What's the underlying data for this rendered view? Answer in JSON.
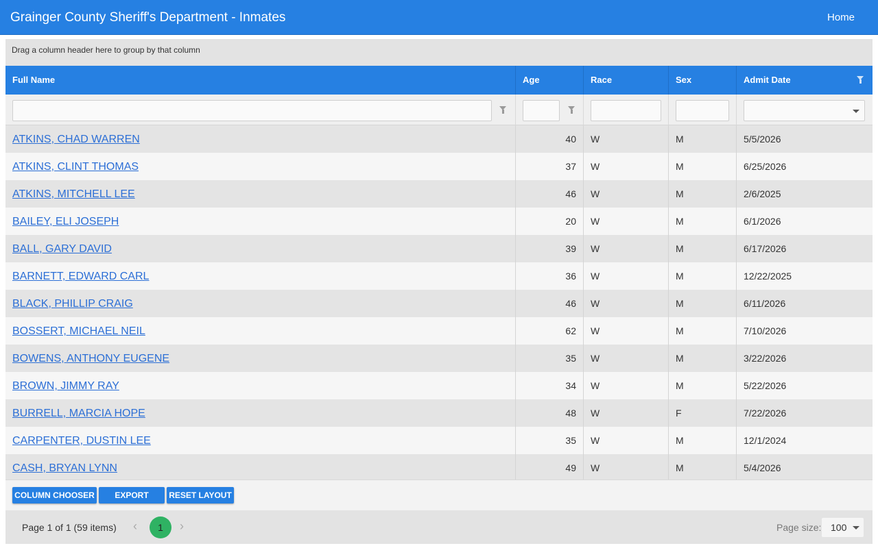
{
  "header": {
    "title": "Grainger County Sheriff's Department - Inmates",
    "home_label": "Home"
  },
  "grid": {
    "group_panel_text": "Drag a column header here to group by that column",
    "columns": [
      "Full Name",
      "Age",
      "Race",
      "Sex",
      "Admit Date"
    ],
    "rows": [
      {
        "name": "ATKINS, CHAD WARREN",
        "age": "40",
        "race": "W",
        "sex": "M",
        "admit": "5/5/2026"
      },
      {
        "name": "ATKINS, CLINT THOMAS",
        "age": "37",
        "race": "W",
        "sex": "M",
        "admit": "6/25/2026"
      },
      {
        "name": "ATKINS, MITCHELL LEE",
        "age": "46",
        "race": "W",
        "sex": "M",
        "admit": "2/6/2025"
      },
      {
        "name": "BAILEY, ELI JOSEPH",
        "age": "20",
        "race": "W",
        "sex": "M",
        "admit": "6/1/2026"
      },
      {
        "name": "BALL, GARY DAVID",
        "age": "39",
        "race": "W",
        "sex": "M",
        "admit": "6/17/2026"
      },
      {
        "name": "BARNETT, EDWARD CARL",
        "age": "36",
        "race": "W",
        "sex": "M",
        "admit": "12/22/2025"
      },
      {
        "name": "BLACK, PHILLIP CRAIG",
        "age": "46",
        "race": "W",
        "sex": "M",
        "admit": "6/11/2026"
      },
      {
        "name": "BOSSERT, MICHAEL NEIL",
        "age": "62",
        "race": "W",
        "sex": "M",
        "admit": "7/10/2026"
      },
      {
        "name": "BOWENS, ANTHONY EUGENE",
        "age": "35",
        "race": "W",
        "sex": "M",
        "admit": "3/22/2026"
      },
      {
        "name": "BROWN, JIMMY RAY",
        "age": "34",
        "race": "W",
        "sex": "M",
        "admit": "5/22/2026"
      },
      {
        "name": "BURRELL, MARCIA HOPE",
        "age": "48",
        "race": "W",
        "sex": "F",
        "admit": "7/22/2026"
      },
      {
        "name": "CARPENTER, DUSTIN LEE",
        "age": "35",
        "race": "W",
        "sex": "M",
        "admit": "12/1/2024"
      },
      {
        "name": "CASH, BRYAN LYNN",
        "age": "49",
        "race": "W",
        "sex": "M",
        "admit": "5/4/2026"
      }
    ]
  },
  "toolbar": {
    "column_chooser": "COLUMN CHOOSER",
    "export": "EXPORT",
    "reset_layout": "RESET LAYOUT"
  },
  "pager": {
    "info": "Page 1 of 1 (59 items)",
    "current_page": "1",
    "page_size_label": "Page size:",
    "page_size": "100"
  },
  "icons": {
    "filter": "funnel-icon",
    "prev": "chevron-left-icon",
    "next": "chevron-right-icon",
    "dropdown": "caret-down-icon"
  },
  "colors": {
    "accent": "#2680e2",
    "link": "#2c6fd6",
    "current_page": "#2fb263"
  }
}
